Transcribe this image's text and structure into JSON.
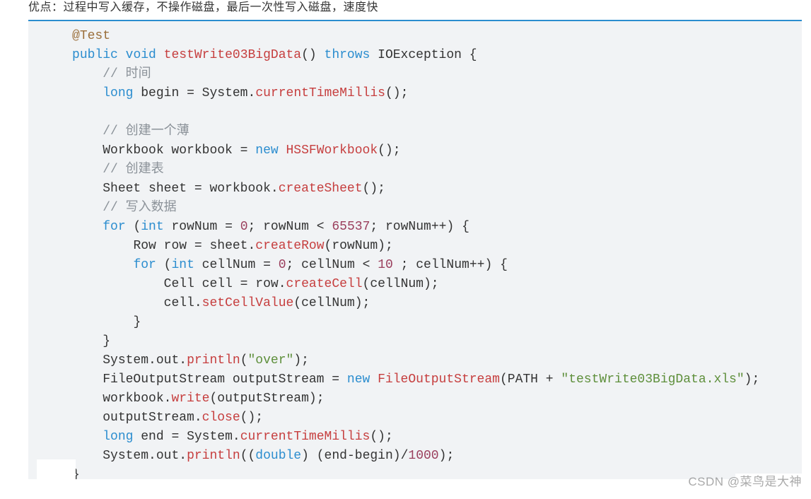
{
  "header": {
    "breadcrumb": "优点：过程中写入缓存，不操作磁盘，最后一次性写入磁盘，速度快"
  },
  "code": {
    "seg01": "@Test",
    "seg02": "public",
    "seg03": " ",
    "seg04": "void",
    "seg05": " ",
    "seg06": "testWrite03BigData",
    "seg07": "()",
    "seg08": " ",
    "seg09": "throws",
    "seg10": " IOException ",
    "seg11": "{",
    "seg12": "// 时间",
    "seg13": "long",
    "seg14": " begin ",
    "seg15": "=",
    "seg16": " System",
    "seg17": ".",
    "seg18": "currentTimeMillis",
    "seg19": "()",
    "seg20": ";",
    "seg21": "// 创建一个薄",
    "seg22": "Workbook workbook ",
    "seg23": "=",
    "seg24": " ",
    "seg25": "new",
    "seg26": " ",
    "seg27": "HSSFWorkbook",
    "seg28": "()",
    "seg29": ";",
    "seg30": "// 创建表",
    "seg31": "Sheet sheet ",
    "seg32": "=",
    "seg33": " workbook",
    "seg34": ".",
    "seg35": "createSheet",
    "seg36": "()",
    "seg37": ";",
    "seg38": "// 写入数据",
    "seg39": "for",
    "seg40": " ",
    "seg41": "(",
    "seg42": "int",
    "seg43": " rowNum ",
    "seg44": "=",
    "seg45": " ",
    "seg46": "0",
    "seg47": ";",
    "seg48": " rowNum ",
    "seg49": "<",
    "seg50": " ",
    "seg51": "65537",
    "seg52": ";",
    "seg53": " rowNum",
    "seg54": "++",
    "seg55": ")",
    "seg56": " ",
    "seg57": "{",
    "seg58": "Row row ",
    "seg59": "=",
    "seg60": " sheet",
    "seg61": ".",
    "seg62": "createRow",
    "seg63": "(",
    "seg64": "rowNum",
    "seg65": ")",
    "seg66": ";",
    "seg67": "for",
    "seg68": " ",
    "seg69": "(",
    "seg70": "int",
    "seg71": " cellNum ",
    "seg72": "=",
    "seg73": " ",
    "seg74": "0",
    "seg75": ";",
    "seg76": " cellNum ",
    "seg77": "<",
    "seg78": " ",
    "seg79": "10",
    "seg80": " ",
    "seg81": ";",
    "seg82": " cellNum",
    "seg83": "++",
    "seg84": ")",
    "seg85": " ",
    "seg86": "{",
    "seg87": "Cell cell ",
    "seg88": "=",
    "seg89": " row",
    "seg90": ".",
    "seg91": "createCell",
    "seg92": "(",
    "seg93": "cellNum",
    "seg94": ")",
    "seg95": ";",
    "seg96": "cell",
    "seg97": ".",
    "seg98": "setCellValue",
    "seg99": "(",
    "seg100": "cellNum",
    "seg101": ")",
    "seg102": ";",
    "seg103": "}",
    "seg104": "}",
    "seg105": "System",
    "seg106": ".",
    "seg107": "out",
    "seg108": ".",
    "seg109": "println",
    "seg110": "(",
    "seg111": "\"over\"",
    "seg112": ")",
    "seg113": ";",
    "seg114": "FileOutputStream outputStream ",
    "seg115": "=",
    "seg116": " ",
    "seg117": "new",
    "seg118": " ",
    "seg119": "FileOutputStream",
    "seg120": "(",
    "seg121": "PATH ",
    "seg122": "+",
    "seg123": " ",
    "seg124": "\"testWrite03BigData.xls\"",
    "seg125": ")",
    "seg126": ";",
    "seg127": "workbook",
    "seg128": ".",
    "seg129": "write",
    "seg130": "(",
    "seg131": "outputStream",
    "seg132": ")",
    "seg133": ";",
    "seg134": "outputStream",
    "seg135": ".",
    "seg136": "close",
    "seg137": "()",
    "seg138": ";",
    "seg139": "long",
    "seg140": " end ",
    "seg141": "=",
    "seg142": " System",
    "seg143": ".",
    "seg144": "currentTimeMillis",
    "seg145": "()",
    "seg146": ";",
    "seg147": "System",
    "seg148": ".",
    "seg149": "out",
    "seg150": ".",
    "seg151": "println",
    "seg152": "((",
    "seg153": "double",
    "seg154": ")",
    "seg155": " ",
    "seg156": "(",
    "seg157": "end",
    "seg158": "-",
    "seg159": "begin",
    "seg160": ")",
    "seg161": "/",
    "seg162": "1000",
    "seg163": ")",
    "seg164": ";",
    "seg165": "}"
  },
  "footer": {
    "language": "java",
    "watermark": "CSDN @菜鸟是大神"
  }
}
